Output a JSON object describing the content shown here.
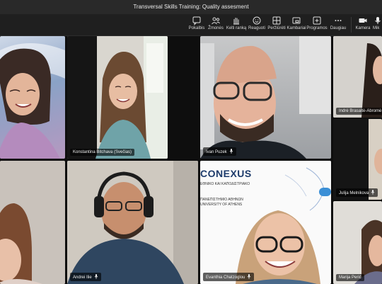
{
  "window": {
    "title": "Transversal Skills Training: Quality assesment"
  },
  "toolbar": {
    "items": [
      {
        "label": "Pokalbis",
        "icon": "chat-icon"
      },
      {
        "label": "Žmonės",
        "icon": "people-icon"
      },
      {
        "label": "Kelti ranką",
        "icon": "raise-hand-icon"
      },
      {
        "label": "Reaguoti",
        "icon": "smiley-icon"
      },
      {
        "label": "Peržiūrėti",
        "icon": "view-grid-icon"
      },
      {
        "label": "Kambariai",
        "icon": "rooms-icon"
      },
      {
        "label": "Programos",
        "icon": "apps-plus-icon"
      },
      {
        "label": "Daugiau",
        "icon": "more-icon"
      },
      {
        "label": "Kamera",
        "icon": "camera-icon"
      },
      {
        "label": "Mik",
        "icon": "microphone-icon"
      }
    ]
  },
  "participants": [
    {
      "name": ""
    },
    {
      "name": "Konstantina Bitchava (Svečias)"
    },
    {
      "name": "Ivan Puzek"
    },
    {
      "name": "Indrė Brasaitė-Abromė"
    },
    {
      "name": "Julija Melnikova"
    },
    {
      "name": ""
    },
    {
      "name": "Andrei Ilie"
    },
    {
      "name": "Evanthia Chatzoglou"
    },
    {
      "name": "Marija Perić"
    }
  ],
  "shared_slide": {
    "logo": "CONEXUS",
    "lines": [
      "ΕΘΝΙΚΟ ΚΑΙ ΚΑΠΟΔΙΣΤΡΙΑΚΟ",
      "ΠΑΝΕΠΙΣΤΗΜΙΟ ΑΘΗΝΩΝ",
      "UNIVERSITY OF ATHENS"
    ]
  },
  "colors": {
    "accent": "#6264a7",
    "tile_bg": "#2b2b2b"
  }
}
